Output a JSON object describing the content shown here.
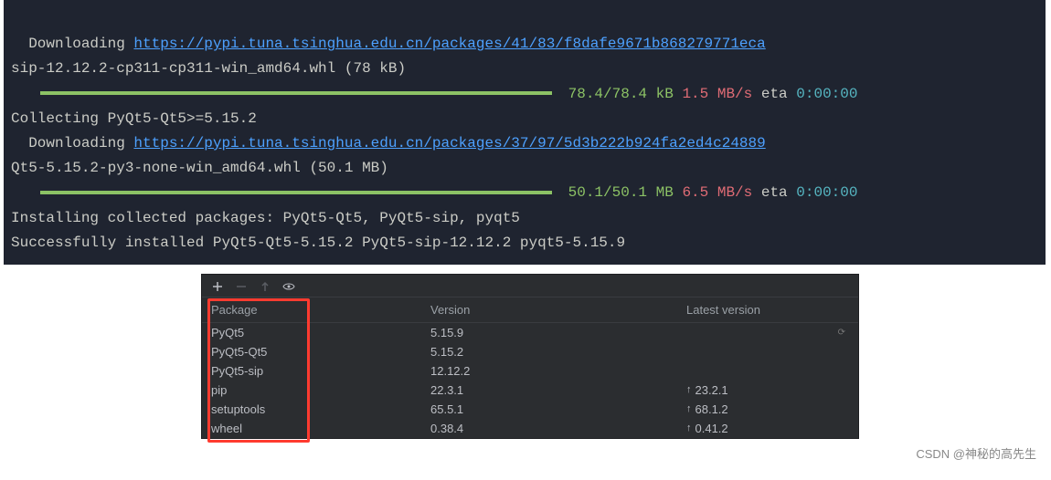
{
  "terminal": {
    "line1_prefix": "  Downloading ",
    "line1_url": "https://pypi.tuna.tsinghua.edu.cn/packages/41/83/f8dafe9671b868279771eca",
    "line2": "sip-12.12.2-cp311-cp311-win_amd64.whl (78 kB)",
    "progress1": {
      "done": "78.4/78.4 kB",
      "speed": "1.5 MB/s",
      "eta_label": " eta ",
      "eta": "0:00:00"
    },
    "line_collecting": "Collecting PyQt5-Qt5>=5.15.2",
    "line4_prefix": "  Downloading ",
    "line4_url": "https://pypi.tuna.tsinghua.edu.cn/packages/37/97/5d3b222b924fa2ed4c24889",
    "line5": "Qt5-5.15.2-py3-none-win_amd64.whl (50.1 MB)",
    "progress2": {
      "done": "50.1/50.1 MB",
      "speed": "6.5 MB/s",
      "eta_label": " eta ",
      "eta": "0:00:00"
    },
    "line_installing": "Installing collected packages: PyQt5-Qt5, PyQt5-sip, pyqt5",
    "line_success": "Successfully installed PyQt5-Qt5-5.15.2 PyQt5-sip-12.12.2 pyqt5-5.15.9"
  },
  "panel": {
    "headers": {
      "name": "Package",
      "version": "Version",
      "latest": "Latest version"
    },
    "rows": [
      {
        "name": "PyQt5",
        "version": "5.15.9",
        "latest": ""
      },
      {
        "name": "PyQt5-Qt5",
        "version": "5.15.2",
        "latest": ""
      },
      {
        "name": "PyQt5-sip",
        "version": "12.12.2",
        "latest": ""
      },
      {
        "name": "pip",
        "version": "22.3.1",
        "latest": "23.2.1"
      },
      {
        "name": "setuptools",
        "version": "65.5.1",
        "latest": "68.1.2"
      },
      {
        "name": "wheel",
        "version": "0.38.4",
        "latest": "0.41.2"
      }
    ]
  },
  "watermark": "CSDN @神秘的高先生"
}
